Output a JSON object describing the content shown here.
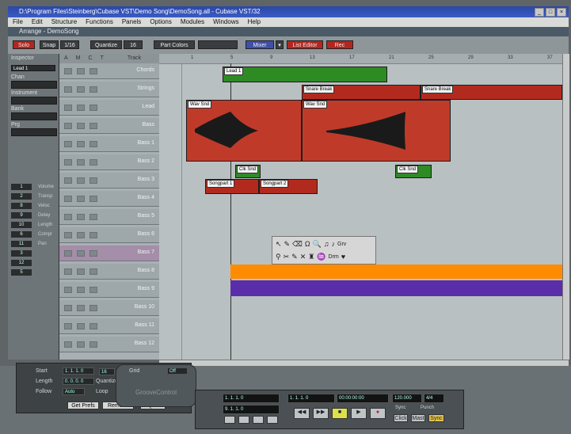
{
  "window": {
    "title": "D:\\Program Files\\Steinberg\\Cubase VST\\Demo Song\\DemoSong.all - Cubase VST/32",
    "controls": [
      "_",
      "□",
      "×"
    ]
  },
  "menu": [
    "File",
    "Edit",
    "Structure",
    "Functions",
    "Panels",
    "Options",
    "Modules",
    "Windows",
    "Help"
  ],
  "arrange_title": "Arrange - DemoSong",
  "toolbar": {
    "solo_label": "Solo",
    "snap_label": "Snap",
    "snap_value": "1/16",
    "quantize_label": "Quantize",
    "quantize_value": "16",
    "part_colors_label": "Part Colors",
    "mixer_label": "Mixer",
    "edit_label": "List Editor",
    "record_label": "Rec",
    "accent_color": "#b3261e"
  },
  "inspector": {
    "label_top": "Inspector",
    "track_name": "Lead 1",
    "labels": [
      "Chan",
      "Instrument",
      "Bank",
      "Prg",
      "Transpose",
      "Velocity",
      "Delay",
      "Length",
      "Compress",
      "Pan"
    ],
    "values": [
      "1",
      "2",
      "8",
      "9",
      "10",
      "6",
      "11",
      "3",
      "12",
      "5"
    ],
    "side_labels": [
      "Volume",
      "Transp",
      "Veloc",
      "Delay",
      "Length",
      "Compr",
      "Pan"
    ]
  },
  "tracklist": {
    "headers": [
      "A",
      "M",
      "C",
      "T",
      "Track"
    ],
    "tracks": [
      {
        "name": "Chords",
        "selected": false
      },
      {
        "name": "Strings",
        "selected": false
      },
      {
        "name": "Lead",
        "selected": false
      },
      {
        "name": "Bass",
        "selected": false
      },
      {
        "name": "Bass 1",
        "selected": false
      },
      {
        "name": "Bass 2",
        "selected": false
      },
      {
        "name": "Bass 3",
        "selected": false
      },
      {
        "name": "Bass 4",
        "selected": false
      },
      {
        "name": "Bass 5",
        "selected": false
      },
      {
        "name": "Bass 6",
        "selected": false
      },
      {
        "name": "Bass 7",
        "selected": true
      },
      {
        "name": "Bass 8",
        "selected": false
      },
      {
        "name": "Bass 9",
        "selected": false
      },
      {
        "name": "Bass 10",
        "selected": false
      },
      {
        "name": "Bass 11",
        "selected": false
      },
      {
        "name": "Bass 12",
        "selected": false
      }
    ]
  },
  "ruler": {
    "ticks": [
      "1",
      "5",
      "9",
      "13",
      "17",
      "21",
      "25",
      "29",
      "33",
      "37"
    ]
  },
  "parts": [
    {
      "label": "Lead 1",
      "color": "#2e8b23"
    },
    {
      "label": "Snare Break",
      "color": "#b22a1e"
    },
    {
      "label": "Snare Break",
      "color": "#b22a1e"
    },
    {
      "label": "Wav Snd",
      "color": "#c03a2a"
    },
    {
      "label": "Wav Snd",
      "color": "#c03a2a"
    },
    {
      "label": "Clk Snd",
      "color": "#2e8b23"
    },
    {
      "label": "Clk Snd",
      "color": "#2e8b23"
    },
    {
      "label": "Songpart 1",
      "color": "#b22a1e"
    },
    {
      "label": "Songpart 2",
      "color": "#b22a1e"
    }
  ],
  "tool_panel": {
    "row1": [
      "↖",
      "✎",
      "⌫",
      "Ω",
      "🔍",
      "♫",
      "♪",
      "Grv"
    ],
    "row2": [
      "⚲",
      "✂",
      "✎",
      "✕",
      "♜",
      "♒",
      "Drm",
      "♥"
    ]
  },
  "bands": {
    "orange": "#ff8c00",
    "purple": "#5a2ea8"
  },
  "edit_panel": {
    "labels": [
      "Start",
      "Length",
      "Follow",
      "Quantize",
      "Grid"
    ],
    "values": [
      "1. 1. 1. 0",
      "0. 0. 0. 0",
      "Auto",
      "16",
      "Off"
    ],
    "loop_label": "Loop",
    "groove_label": "GrooveControl",
    "buttons": [
      "Get Prefs",
      "Remove",
      "Quit"
    ]
  },
  "transport": {
    "left_locator": "1. 1. 1. 0",
    "right_locator": "9. 1. 1. 0",
    "position": "1. 1. 1. 0",
    "time": "00:00:00:00",
    "tempo": "120.000",
    "signature": "4/4",
    "mode_labels": [
      "Sync",
      "Punch"
    ],
    "buttons": [
      "◀◀",
      "▶▶",
      "■",
      "▶",
      "●"
    ],
    "extra_buttons": [
      "Click",
      "Mast",
      "Sync"
    ]
  }
}
